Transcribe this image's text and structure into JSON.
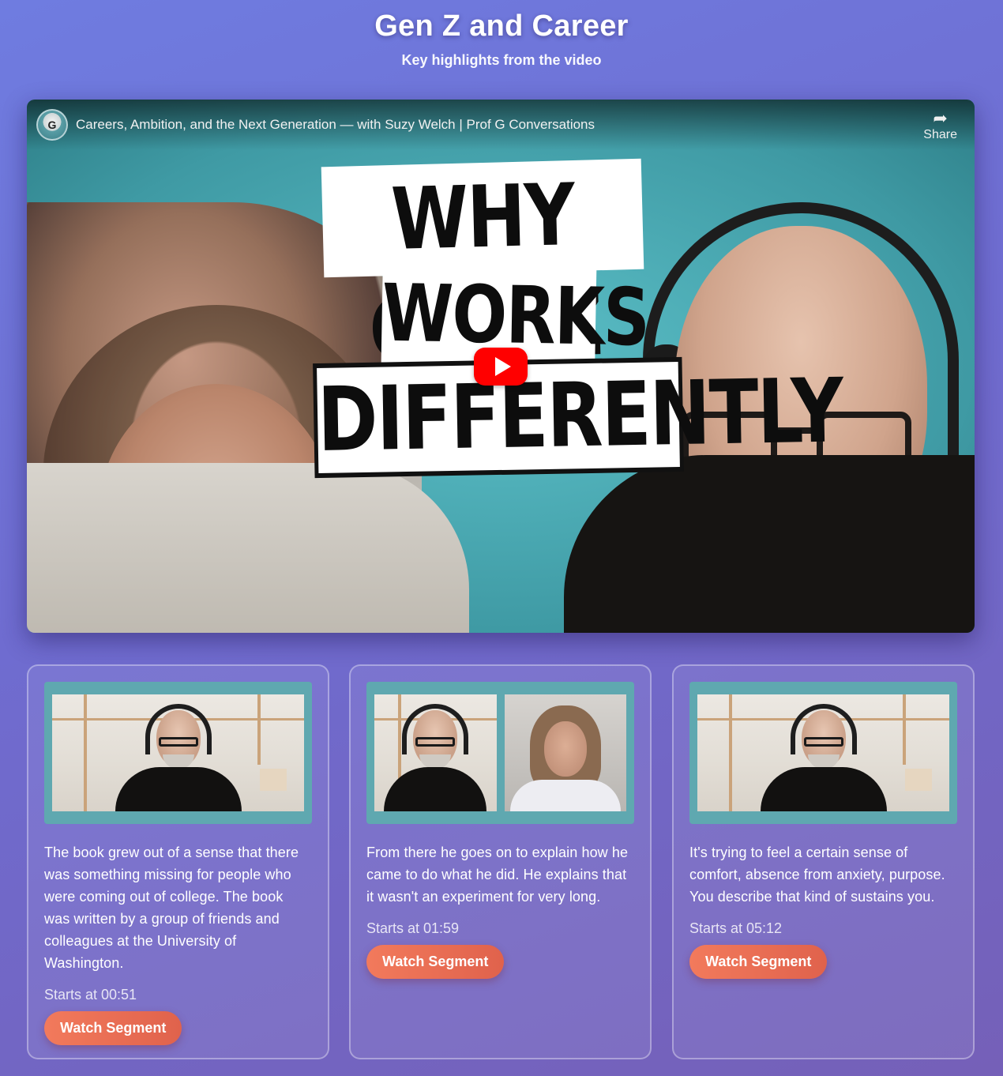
{
  "page": {
    "title": "Gen Z and Career",
    "subtitle": "Key highlights from the video"
  },
  "video": {
    "title": "Careers, Ambition, and the Next Generation — with Suzy Welch | Prof G Conversations",
    "share_label": "Share",
    "thumbnail_text": [
      "WHY GEN Z",
      "WORKS",
      "DIFFERENTLY"
    ],
    "play_icon": "play-icon",
    "share_icon": "share-arrow-icon"
  },
  "segments": [
    {
      "text": "The book grew out of a sense that there was something missing for people who were coming out of college. The book was written by a group of friends and colleagues at the University of Washington.",
      "start": "Starts at 00:51",
      "button": "Watch Segment"
    },
    {
      "text": "From there he goes on to explain how he came to do what he did. He explains that it wasn't an experiment for very long.",
      "start": "Starts at 01:59",
      "button": "Watch Segment"
    },
    {
      "text": "It's trying to feel a certain sense of comfort, absence from anxiety, purpose. You describe that kind of sustains you.",
      "start": "Starts at 05:12",
      "button": "Watch Segment"
    }
  ],
  "colors": {
    "background_start": "#6f7ce0",
    "background_end": "#7560b8",
    "button_accent": "#e9684f",
    "youtube_red": "#ff0000",
    "thumbnail_border": "#5fa8b0"
  }
}
